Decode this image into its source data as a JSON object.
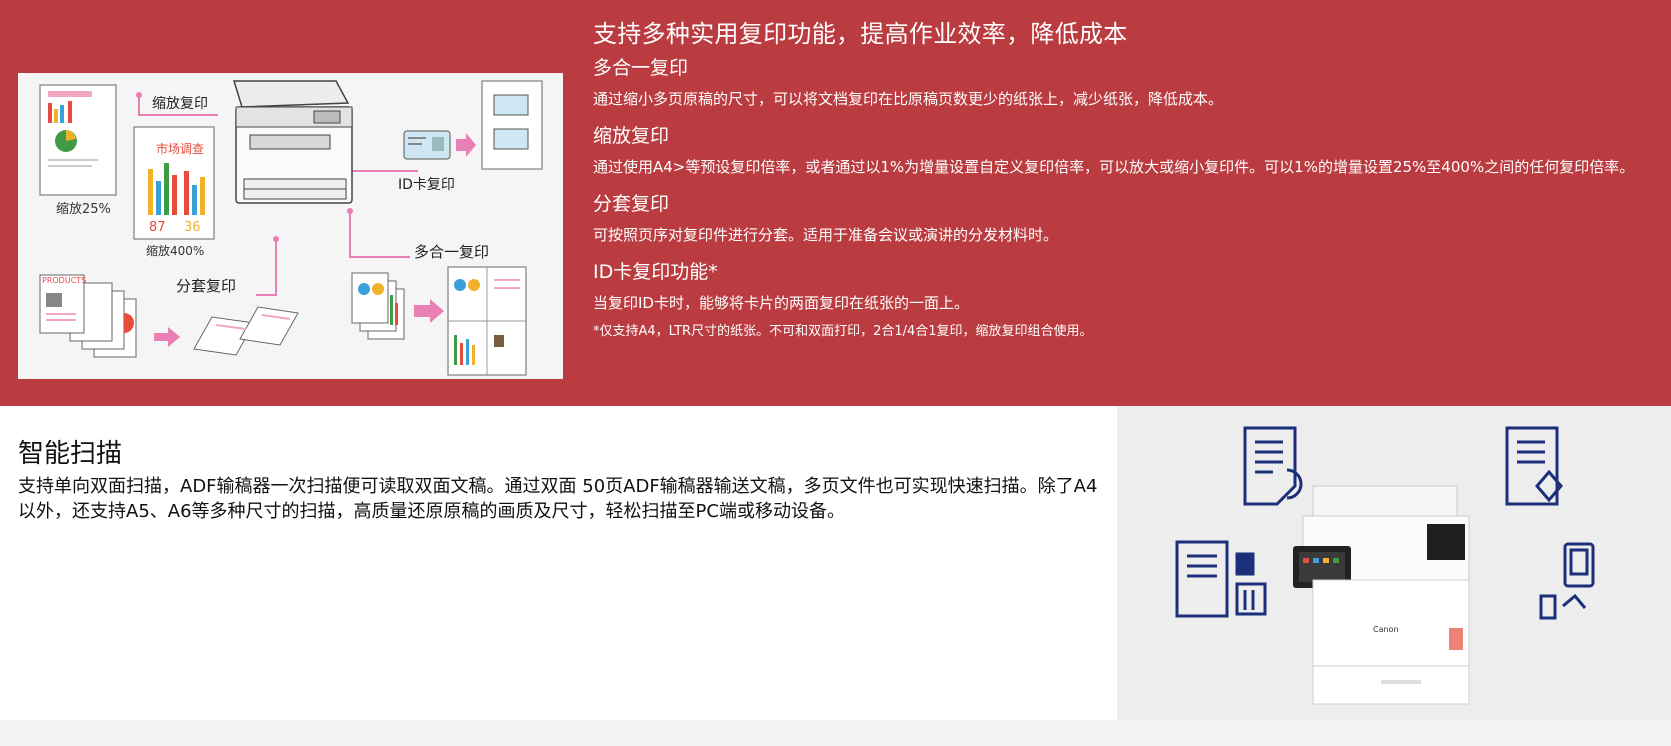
{
  "copy_section": {
    "title": "支持多种实用复印功能，提高作业效率，降低成本",
    "features": [
      {
        "title": "多合一复印",
        "desc": "通过缩小多页原稿的尺寸，可以将文档复印在比原稿页数更少的纸张上，减少纸张，降低成本。"
      },
      {
        "title": "缩放复印",
        "desc": "通过使用A4>等预设复印倍率，或者通过以1%为增量设置自定义复印倍率，可以放大或缩小复印件。可以1%的增量设置25%至400%之间的任何复印倍率。"
      },
      {
        "title": "分套复印",
        "desc": "可按照页序对复印件进行分套。适用于准备会议或演讲的分发材料时。"
      },
      {
        "title": "ID卡复印功能*",
        "desc": "当复印ID卡时，能够将卡片的两面复印在纸张的一面上。"
      }
    ],
    "note": "*仅支持A4，LTR尺寸的纸张。不可和双面打印，2合1/4合1复印，缩放复印组合使用。",
    "illustration": {
      "label_zoom": "缩放复印",
      "label_id": "ID卡复印",
      "label_nup": "多合一复印",
      "label_sort": "分套复印",
      "label_25": "缩放25%",
      "label_400": "缩放400%",
      "doc_heading": "市场调查",
      "pct_a": "87",
      "pct_b": "36",
      "products": "PRODUCTS"
    }
  },
  "scan_section": {
    "title": "智能扫描",
    "desc": "支持单向双面扫描，ADF输稿器一次扫描便可读取双面文稿。通过双面 50页ADF输稿器输送文稿，多页文件也可实现快速扫描。除了A4以外，还支持A5、A6等多种尺寸的扫描，高质量还原原稿的画质及尺寸，轻松扫描至PC端或移动设备。",
    "brand": "Canon"
  },
  "colors": {
    "section_red": "#bb3c40",
    "accent_pink": "#e87fb5",
    "icon_navy": "#1b2f7a"
  }
}
